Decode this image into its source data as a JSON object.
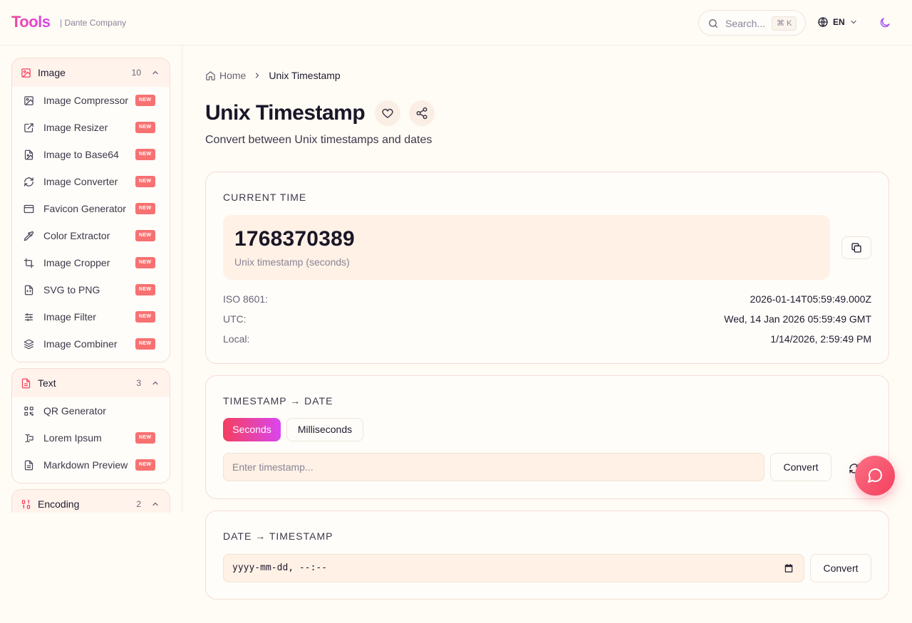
{
  "header": {
    "logo": "Tools",
    "company": "| Dante Company",
    "search_placeholder": "Search...",
    "search_shortcut": "⌘ K",
    "language": "EN"
  },
  "sidebar": {
    "groups": [
      {
        "name": "Image",
        "count": "10",
        "items": [
          {
            "label": "Image Compressor",
            "badge": "NEW"
          },
          {
            "label": "Image Resizer",
            "badge": "NEW"
          },
          {
            "label": "Image to Base64",
            "badge": "NEW"
          },
          {
            "label": "Image Converter",
            "badge": "NEW"
          },
          {
            "label": "Favicon Generator",
            "badge": "NEW"
          },
          {
            "label": "Color Extractor",
            "badge": "NEW"
          },
          {
            "label": "Image Cropper",
            "badge": "NEW"
          },
          {
            "label": "SVG to PNG",
            "badge": "NEW"
          },
          {
            "label": "Image Filter",
            "badge": "NEW"
          },
          {
            "label": "Image Combiner",
            "badge": "NEW"
          }
        ]
      },
      {
        "name": "Text",
        "count": "3",
        "items": [
          {
            "label": "QR Generator",
            "badge": ""
          },
          {
            "label": "Lorem Ipsum",
            "badge": "NEW"
          },
          {
            "label": "Markdown Preview",
            "badge": "NEW"
          }
        ]
      },
      {
        "name": "Encoding",
        "count": "2",
        "items": []
      }
    ]
  },
  "breadcrumb": {
    "home": "Home",
    "current": "Unix Timestamp"
  },
  "page": {
    "title": "Unix Timestamp",
    "subtitle": "Convert between Unix timestamps and dates"
  },
  "current_time": {
    "title": "CURRENT TIME",
    "timestamp": "1768370389",
    "timestamp_label": "Unix timestamp (seconds)",
    "rows": [
      {
        "key": "ISO 8601:",
        "value": "2026-01-14T05:59:49.000Z"
      },
      {
        "key": "UTC:",
        "value": "Wed, 14 Jan 2026 05:59:49 GMT"
      },
      {
        "key": "Local:",
        "value": "1/14/2026, 2:59:49 PM"
      }
    ]
  },
  "ts_to_date": {
    "title": "TIMESTAMP → DATE",
    "unit_seconds": "Seconds",
    "unit_milliseconds": "Milliseconds",
    "selected_unit": "Seconds",
    "input_placeholder": "Enter timestamp...",
    "convert_label": "Convert"
  },
  "date_to_ts": {
    "title": "DATE → TIMESTAMP",
    "input_placeholder": "yyyy-mm-dd, --:--",
    "convert_label": "Convert"
  },
  "colors": {
    "accent": "#f43f5e",
    "brand_gradient_end": "#d946ef",
    "badge": "#f87171",
    "background": "#fffbf5"
  }
}
